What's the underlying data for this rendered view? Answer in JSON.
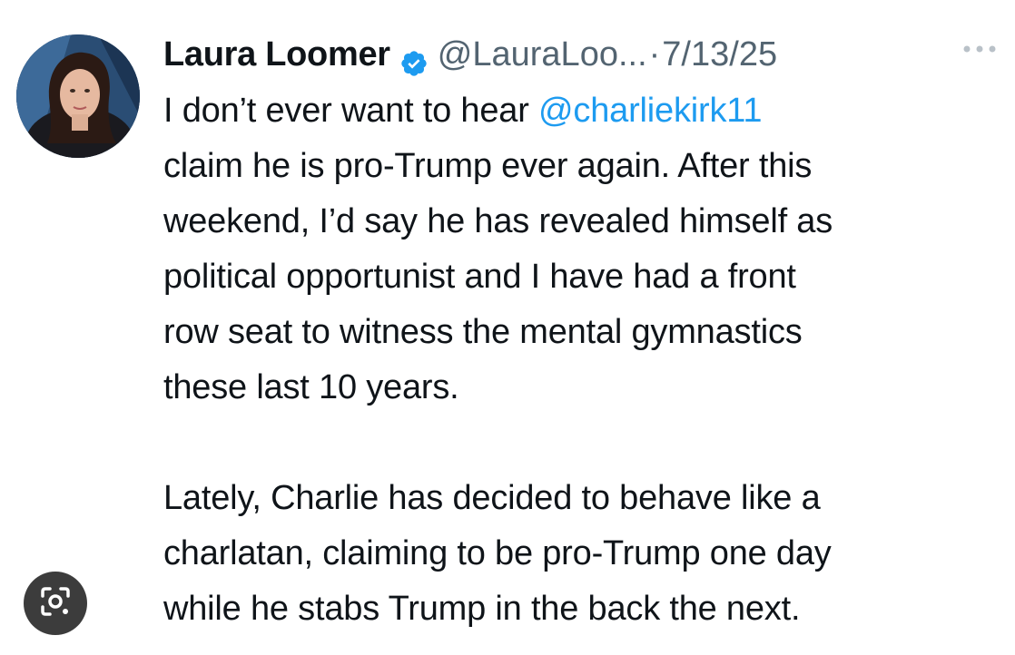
{
  "author": {
    "display_name": "Laura Loomer",
    "verified_icon": "verified-badge-icon",
    "handle": "@LauraLoo...",
    "separator": "·",
    "date": "7/13/25"
  },
  "more_icon": "ellipsis-icon",
  "tweet": {
    "lines": [
      {
        "before": "I don’t ever want to hear ",
        "mention": "@charliekirk11"
      },
      {
        "text": "claim he is pro-Trump ever again. After this"
      },
      {
        "text": "weekend, I’d say he has revealed himself as"
      },
      {
        "text": "political opportunist and I have had a front"
      },
      {
        "text": "row seat to witness the mental gymnastics"
      },
      {
        "text": "these last 10 years."
      },
      {
        "text": ""
      },
      {
        "text": "Lately, Charlie has decided to behave like a"
      },
      {
        "text": "charlatan, claiming to be pro-Trump one day"
      },
      {
        "text": "while he stabs Trump in the back the next."
      }
    ]
  },
  "lens_button_icon": "image-search-lens-icon",
  "colors": {
    "text": "#0f1419",
    "secondary": "#536471",
    "mention": "#1d9bf0",
    "verified": "#1d9bf0"
  }
}
